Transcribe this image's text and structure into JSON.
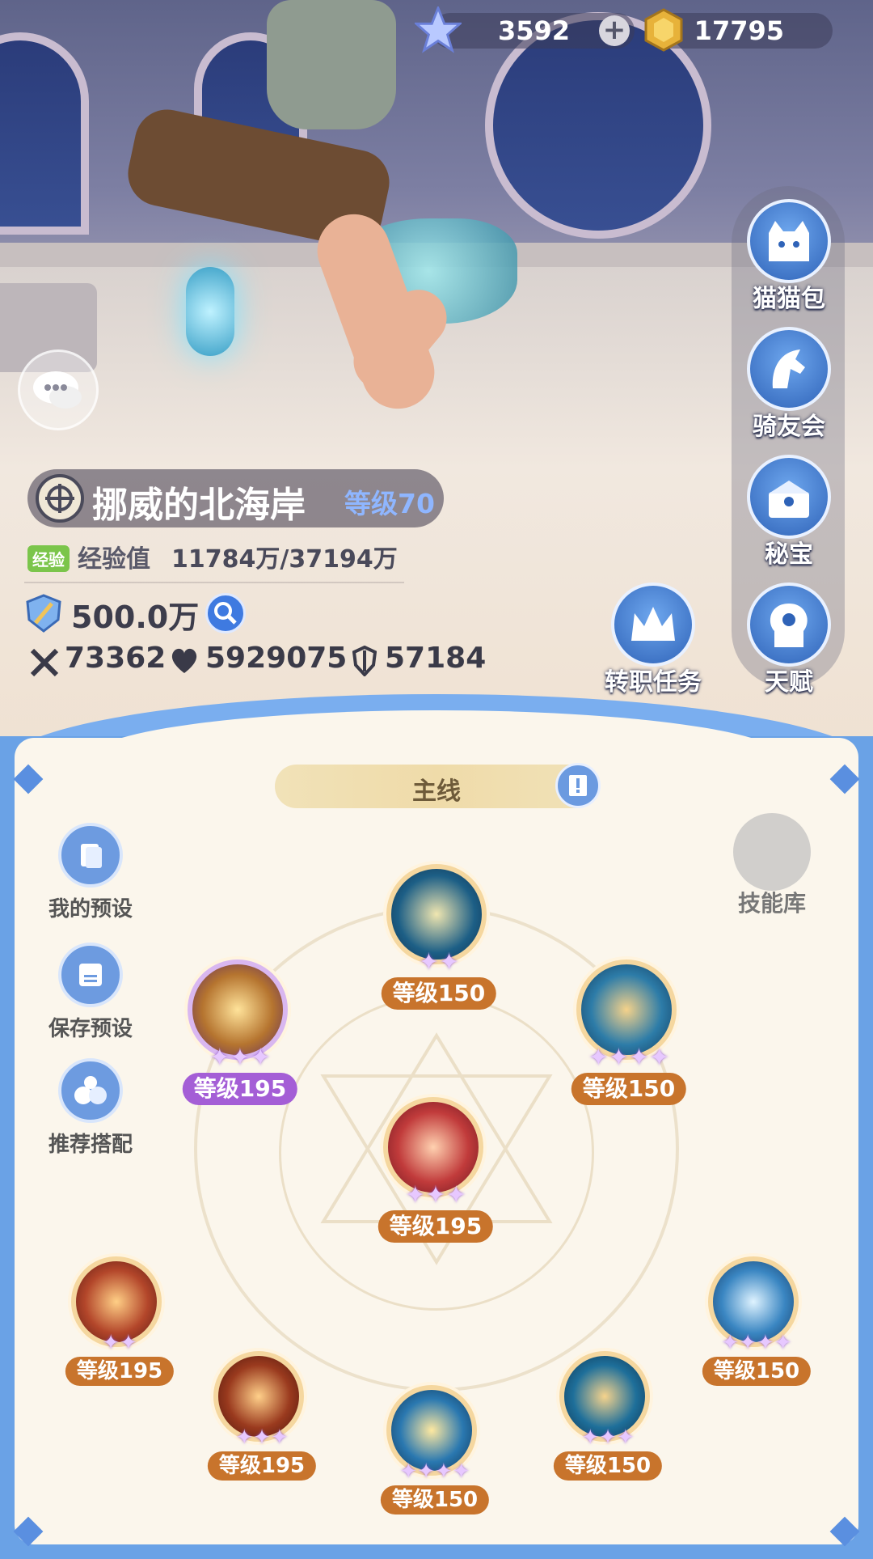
{
  "currency": {
    "gems": "3592",
    "gold": "17795"
  },
  "character": {
    "name": "挪威的北海岸",
    "level_text": "等级70",
    "exp_tag": "经验",
    "exp_label": "经验值",
    "exp_value": "11784万/37194万",
    "power": "500.0万",
    "attack": "73362",
    "hp": "5929075",
    "defense": "57184"
  },
  "side_menu": {
    "cat_bag": "猫猫包",
    "rider_club": "骑友会",
    "treasure": "秘宝",
    "job_quest": "转职任务",
    "talent": "天赋"
  },
  "panel": {
    "tab": "主线",
    "my_preset": "我的预设",
    "save_preset": "保存预设",
    "recommended": "推荐搭配",
    "skill_library": "技能库"
  },
  "skills": [
    {
      "level": "等级150",
      "stars": 2
    },
    {
      "level": "等级195",
      "stars": 3
    },
    {
      "level": "等级150",
      "stars": 4
    },
    {
      "level": "等级195",
      "stars": 3
    },
    {
      "level": "等级195",
      "stars": 2
    },
    {
      "level": "等级195",
      "stars": 3
    },
    {
      "level": "等级150",
      "stars": 4
    },
    {
      "level": "等级150",
      "stars": 3
    },
    {
      "level": "等级150",
      "stars": 4
    }
  ],
  "colors": {
    "level_orange": "#c8742c",
    "level_purple": "#a45ed6",
    "panel_blue": "#6aa2e6"
  }
}
